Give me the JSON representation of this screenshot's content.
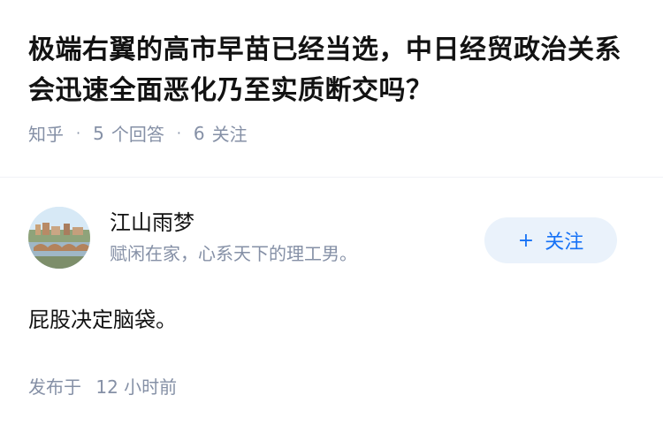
{
  "question": {
    "title": "极端右翼的高市早苗已经当选，中日经贸政治关系会迅速全面恶化乃至实质断交吗？",
    "source": "知乎",
    "answer_count": "5",
    "answer_label": "个回答",
    "follower_count": "6",
    "follower_label": "关注"
  },
  "answer": {
    "author_name": "江山雨梦",
    "author_bio": "赋闲在家，心系天下的理工男。",
    "follow_plus": "+",
    "follow_label": "关注",
    "content": "屁股决定脑袋。",
    "published_prefix": "发布于",
    "published_time": "12 小时前"
  },
  "colors": {
    "accent": "#1772f6",
    "follow_bg": "#eaf2fb",
    "meta_text": "#8590a6"
  }
}
